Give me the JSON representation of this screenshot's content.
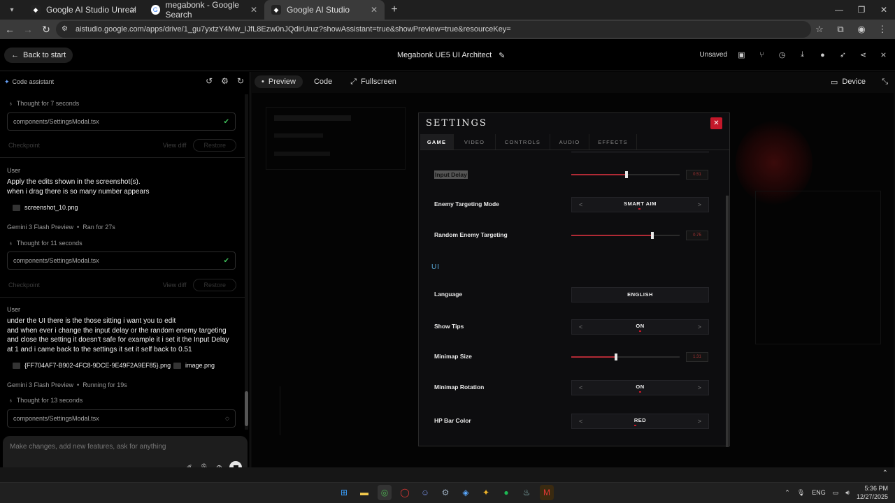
{
  "browser": {
    "tabs": [
      {
        "title": "Google AI Studio Unreal",
        "active": false
      },
      {
        "title": "megabonk - Google Search",
        "active": false
      },
      {
        "title": "Google AI Studio",
        "active": true
      }
    ],
    "url": "aistudio.google.com/apps/drive/1_gu7yxtzY4Mw_IJfL8Ezw0nJQdirUruz?showAssistant=true&showPreview=true&resourceKey="
  },
  "app": {
    "back_label": "Back to start",
    "title": "Megabonk UE5 UI Architect",
    "status": "Unsaved"
  },
  "assistant": {
    "header": "Code assistant",
    "thought1": "Thought for 7 seconds",
    "file1": "components/SettingsModal.tsx",
    "checkpoint1": "Checkpoint",
    "view_diff": "View diff",
    "restore": "Restore",
    "user_label": "User",
    "msg1": "Apply the edits shown in the screenshot(s).\nwhen i drag there is so many number appears",
    "attach1": "screenshot_10.png",
    "model1": "Gemini 3 Flash Preview",
    "run1": "Ran for 27s",
    "thought2": "Thought for 11 seconds",
    "file2": "components/SettingsModal.tsx",
    "checkpoint2": "Checkpoint",
    "msg2": "under the UI there is the those sitting i want you to edit\nand when ever i change the input delay or the random enemy targeting\nand close the setting it doesn't safe for example it i set it the Input Delay\nat 1 and i came back to the settings it set it self back to 0.51",
    "attach2": "{FF704AF7-B902-4FC8-9DCE-9E49F2A9EF85}.png",
    "attach3": "image.png",
    "model2": "Gemini 3 Flash Preview",
    "run2": "Running for 19s",
    "thought3": "Thought for 13 seconds",
    "file3": "components/SettingsModal.tsx",
    "input_placeholder": "Make changes, add new features, ask for anything"
  },
  "preview": {
    "tabs": [
      "Preview",
      "Code",
      "Fullscreen"
    ],
    "device": "Device"
  },
  "settings": {
    "title": "SETTINGS",
    "tabs": [
      "GAME",
      "VIDEO",
      "CONTROLS",
      "AUDIO",
      "EFFECTS"
    ],
    "rows": {
      "input_delay": {
        "label": "Input Delay",
        "value": "0.51",
        "level": 0.51
      },
      "enemy_targeting_mode": {
        "label": "Enemy Targeting Mode",
        "value": "SMART AIM"
      },
      "random_enemy_targeting": {
        "label": "Random Enemy Targeting",
        "value": "0.75",
        "level": 0.75
      },
      "ui_section": "UI",
      "language": {
        "label": "Language",
        "value": "ENGLISH"
      },
      "show_tips": {
        "label": "Show Tips",
        "value": "ON"
      },
      "minimap_size": {
        "label": "Minimap Size",
        "value": "1.31",
        "level": 0.41
      },
      "minimap_rotation": {
        "label": "Minimap Rotation",
        "value": "ON"
      },
      "hp_bar_color": {
        "label": "HP Bar Color",
        "value": "RED"
      }
    }
  },
  "taskbar": {
    "lang": "ENG",
    "time": "5:36 PM",
    "date": "12/27/2025"
  },
  "colors": {
    "accent_red": "#c4182a",
    "section_blue": "#5aa9d8"
  }
}
